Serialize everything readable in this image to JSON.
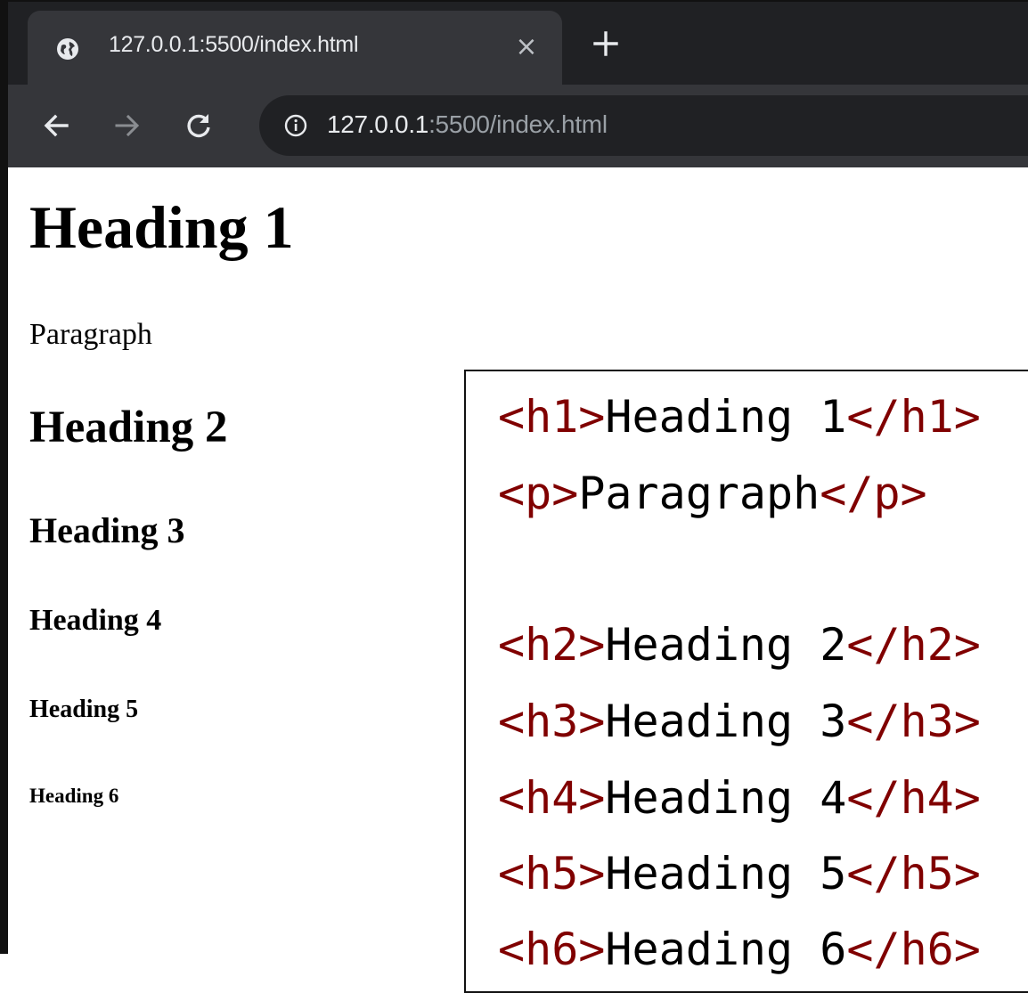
{
  "browser": {
    "tab": {
      "title": "127.0.0.1:5500/index.html",
      "close_glyph": "×",
      "favicon": "globe-icon"
    },
    "new_tab_icon": "plus-icon",
    "nav": {
      "back_icon": "arrow-left-icon",
      "forward_icon": "arrow-right-icon",
      "reload_icon": "reload-icon"
    },
    "address": {
      "info_icon": "info-icon",
      "host": "127.0.0.1",
      "rest": ":5500/index.html"
    }
  },
  "page": {
    "h1": "Heading 1",
    "p": "Paragraph",
    "h2": "Heading 2",
    "h3": "Heading 3",
    "h4": "Heading 4",
    "h5": "Heading 5",
    "h6": "Heading 6"
  },
  "code": {
    "lines": [
      {
        "open": "<h1>",
        "text": "Heading 1",
        "close": "</h1>"
      },
      {
        "open": "<p>",
        "text": "Paragraph",
        "close": "</p>"
      },
      {
        "open": "",
        "text": "",
        "close": ""
      },
      {
        "open": "<h2>",
        "text": "Heading 2",
        "close": "</h2>"
      },
      {
        "open": "<h3>",
        "text": "Heading 3",
        "close": "</h3>"
      },
      {
        "open": "<h4>",
        "text": "Heading 4",
        "close": "</h4>"
      },
      {
        "open": "<h5>",
        "text": "Heading 5",
        "close": "</h5>"
      },
      {
        "open": "<h6>",
        "text": "Heading 6",
        "close": "</h6>"
      }
    ]
  },
  "colors": {
    "chrome_dark": "#202124",
    "chrome_mid": "#35363a",
    "code_tag": "#800000"
  }
}
